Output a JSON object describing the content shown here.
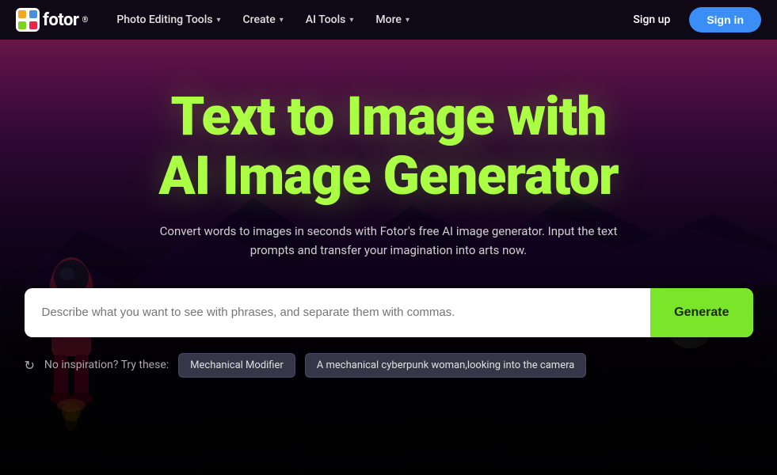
{
  "logo": {
    "text": "fotor",
    "sup": "®"
  },
  "nav": {
    "items": [
      {
        "label": "Photo Editing Tools",
        "chevron": "▾",
        "id": "photo-editing-tools"
      },
      {
        "label": "Create",
        "chevron": "▾",
        "id": "create"
      },
      {
        "label": "AI Tools",
        "chevron": "▾",
        "id": "ai-tools"
      },
      {
        "label": "More",
        "chevron": "▾",
        "id": "more"
      }
    ],
    "sign_up": "Sign up",
    "sign_in": "Sign in"
  },
  "hero": {
    "title_line1": "Text to Image with",
    "title_line2": "AI Image Generator",
    "subtitle": "Convert words to images in seconds with Fotor's free AI image generator. Input the text prompts and transfer your imagination into arts now."
  },
  "search": {
    "placeholder": "Describe what you want to see with phrases, and separate them with commas.",
    "generate_label": "Generate"
  },
  "inspiration": {
    "label": "No inspiration? Try these:",
    "chips": [
      {
        "label": "Mechanical Modifier"
      },
      {
        "label": "A mechanical cyberpunk woman,looking into the camera"
      }
    ]
  },
  "colors": {
    "accent_green": "#7ae62a",
    "title_green": "#aaff44",
    "nav_bg": "rgba(10, 8, 20, 0.95)",
    "sign_in_blue": "#3a8ef6"
  }
}
